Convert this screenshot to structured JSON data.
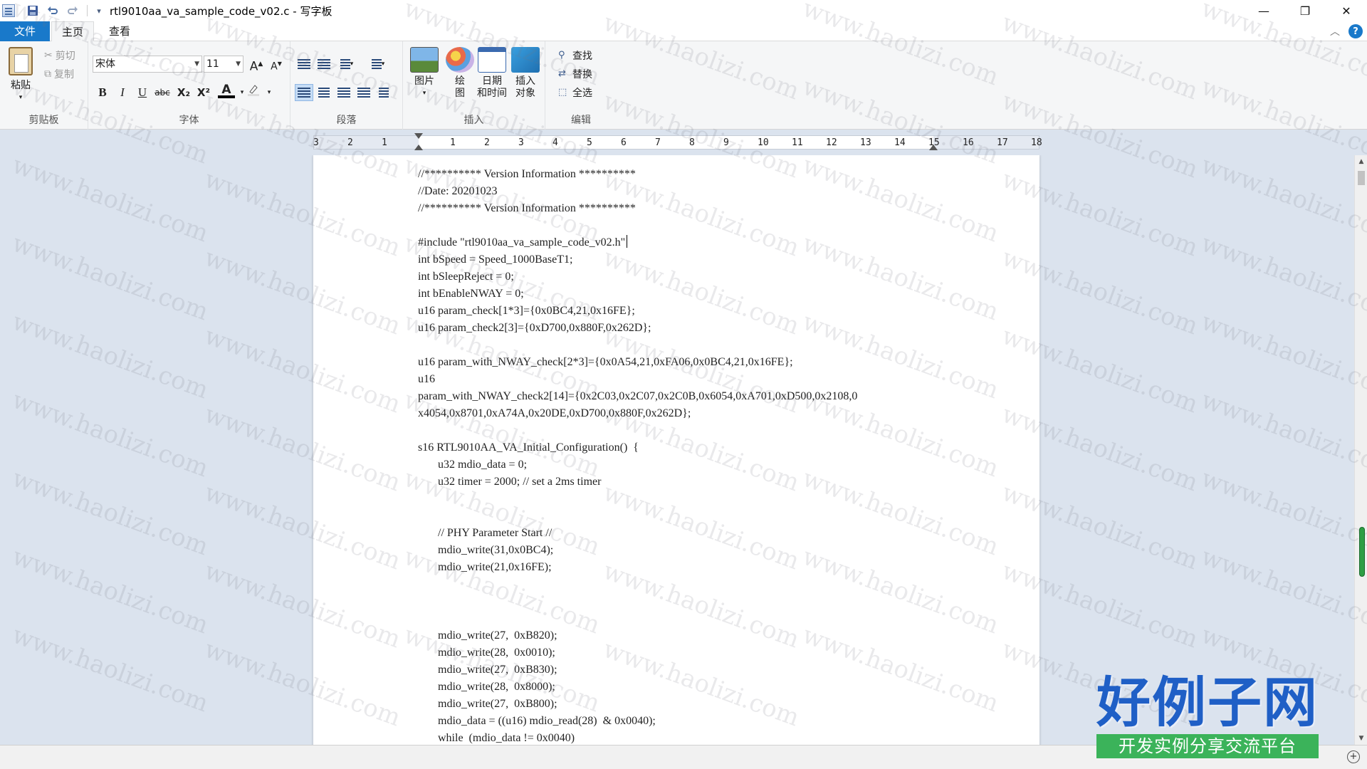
{
  "window": {
    "title": "rtl9010aa_va_sample_code_v02.c - 写字板",
    "controls": {
      "minimize": "—",
      "maximize": "❐",
      "close": "✕"
    }
  },
  "quick_access": {
    "save_icon": "save-icon",
    "undo_icon": "undo-icon",
    "redo_icon": "redo-icon",
    "customize": "▾"
  },
  "tabs": {
    "file": "文件",
    "home": "主页",
    "view": "查看"
  },
  "help": "?",
  "ribbon": {
    "clipboard": {
      "label": "剪贴板",
      "paste": "粘贴",
      "cut": "剪切",
      "copy": "复制"
    },
    "font": {
      "label": "字体",
      "family": "宋体",
      "size": "11",
      "grow": "A",
      "shrink": "A",
      "bold": "B",
      "italic": "I",
      "underline": "U",
      "strike": "abc",
      "subscript": "X₂",
      "superscript": "X²",
      "color": "A"
    },
    "paragraph": {
      "label": "段落"
    },
    "insert": {
      "label": "插入",
      "picture": "图片",
      "draw_1": "绘",
      "draw_2": "图",
      "datetime_1": "日期",
      "datetime_2": "和时间",
      "object_1": "插入",
      "object_2": "对象"
    },
    "edit": {
      "label": "编辑",
      "find": "查找",
      "replace": "替换",
      "select_all": "全选"
    }
  },
  "ruler": {
    "ticks": [
      "3",
      "2",
      "1",
      "1",
      "2",
      "3",
      "4",
      "5",
      "6",
      "7",
      "8",
      "9",
      "10",
      "11",
      "12",
      "13",
      "14",
      "15",
      "16",
      "17",
      "18"
    ]
  },
  "document": {
    "lines": [
      "//********** Version Information **********",
      "//Date: 20201023",
      "//********** Version Information **********",
      "",
      "#include \"rtl9010aa_va_sample_code_v02.h\"",
      "int bSpeed = Speed_1000BaseT1;",
      "int bSleepReject = 0;",
      "int bEnableNWAY = 0;",
      "u16 param_check[1*3]={0x0BC4,21,0x16FE};",
      "u16 param_check2[3]={0xD700,0x880F,0x262D};",
      "",
      "u16 param_with_NWAY_check[2*3]={0x0A54,21,0xFA06,0x0BC4,21,0x16FE};",
      "u16",
      "param_with_NWAY_check2[14]={0x2C03,0x2C07,0x2C0B,0x6054,0xA701,0xD500,0x2108,0",
      "x4054,0x8701,0xA74A,0x20DE,0xD700,0x880F,0x262D};",
      "",
      "s16 RTL9010AA_VA_Initial_Configuration()  {",
      "       u32 mdio_data = 0;",
      "       u32 timer = 2000; // set a 2ms timer",
      "",
      "",
      "       // PHY Parameter Start //",
      "       mdio_write(31,0x0BC4);",
      "       mdio_write(21,0x16FE);",
      "",
      "",
      "",
      "       mdio_write(27,  0xB820);",
      "       mdio_write(28,  0x0010);",
      "       mdio_write(27,  0xB830);",
      "       mdio_write(28,  0x8000);",
      "       mdio_write(27,  0xB800);",
      "       mdio_data = ((u16) mdio_read(28)  & 0x0040);",
      "       while  (mdio_data != 0x0040)"
    ]
  },
  "watermark": "www.haolizi.com",
  "logo": {
    "main": "好例子网",
    "sub": "开发实例分享交流平台"
  },
  "colors": {
    "accent": "#1979ca",
    "logo_blue": "#1f5fc6",
    "logo_green": "#3bb35a"
  }
}
